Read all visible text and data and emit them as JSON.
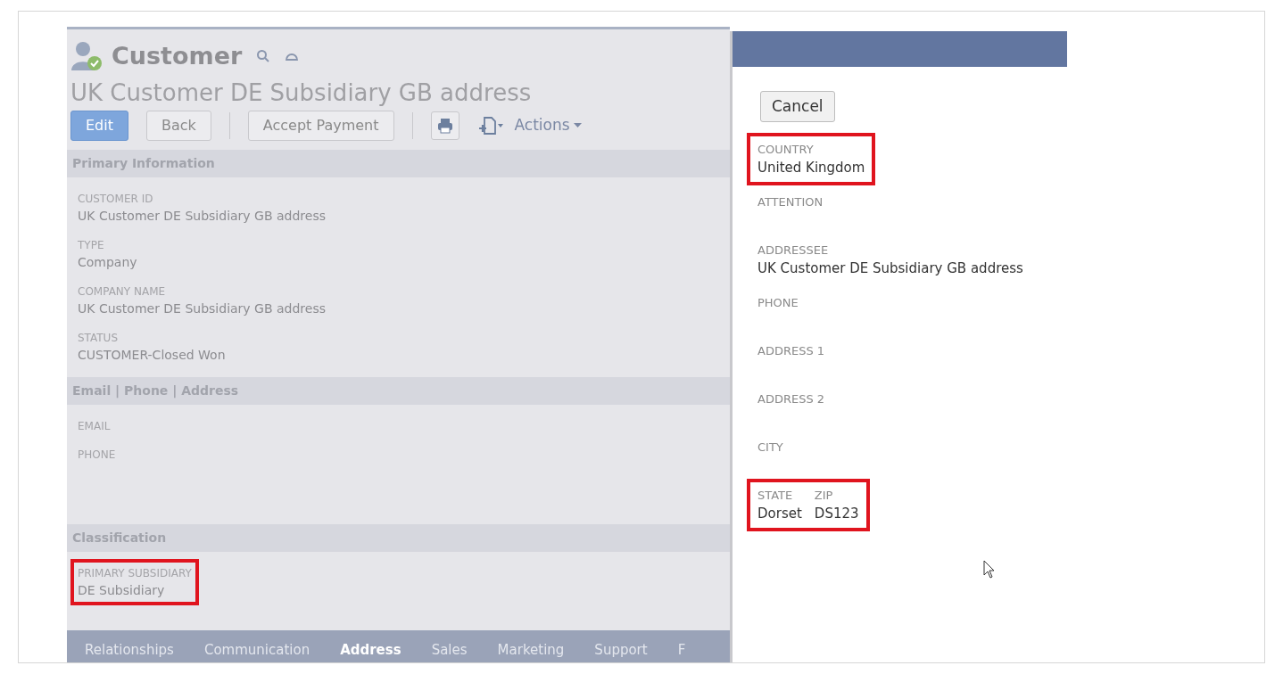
{
  "record": {
    "type_label": "Customer",
    "title": "UK Customer DE Subsidiary GB address"
  },
  "buttons": [
    {
      "label": "Edit",
      "kind": "primary"
    },
    {
      "label": "Back",
      "kind": "secondary"
    },
    {
      "label": "Accept Payment",
      "kind": "secondary"
    }
  ],
  "actions_menu": "Actions",
  "sections": [
    {
      "title": "Primary Information",
      "fields": [
        {
          "label": "CUSTOMER ID",
          "value": "UK Customer DE Subsidiary GB address",
          "highlighted": false
        },
        {
          "label": "TYPE",
          "value": "Company",
          "highlighted": false
        },
        {
          "label": "COMPANY NAME",
          "value": "UK Customer DE Subsidiary GB address",
          "highlighted": false
        },
        {
          "label": "STATUS",
          "value": "CUSTOMER-Closed Won",
          "highlighted": false
        }
      ]
    },
    {
      "title": "Email | Phone | Address",
      "fields": [
        {
          "label": "EMAIL",
          "highlighted": false
        },
        {
          "label": "PHONE",
          "highlighted": false
        }
      ]
    },
    {
      "title": "Classification",
      "fields": [
        {
          "label": "PRIMARY SUBSIDIARY",
          "value": "DE Subsidiary",
          "highlighted": true
        }
      ]
    }
  ],
  "subtabs": [
    {
      "label": "Relationships",
      "selected": false
    },
    {
      "label": "Communication",
      "selected": false
    },
    {
      "label": "Address",
      "selected": true
    },
    {
      "label": "Sales",
      "selected": false
    },
    {
      "label": "Marketing",
      "selected": false
    },
    {
      "label": "Support",
      "selected": false
    },
    {
      "label": "F",
      "selected": false
    }
  ],
  "address_popup": {
    "cancel_button": "Cancel",
    "fields": [
      {
        "highlighted": true,
        "columns": [
          {
            "label": "COUNTRY",
            "value": "United Kingdom"
          }
        ]
      },
      {
        "highlighted": false,
        "columns": [
          {
            "label": "ATTENTION"
          }
        ]
      },
      {
        "highlighted": false,
        "columns": [
          {
            "label": "ADDRESSEE",
            "value": "UK Customer DE Subsidiary GB address"
          }
        ]
      },
      {
        "highlighted": false,
        "columns": [
          {
            "label": "PHONE"
          }
        ]
      },
      {
        "highlighted": false,
        "columns": [
          {
            "label": "ADDRESS 1"
          }
        ]
      },
      {
        "highlighted": false,
        "columns": [
          {
            "label": "ADDRESS 2"
          }
        ]
      },
      {
        "highlighted": false,
        "columns": [
          {
            "label": "CITY"
          }
        ]
      },
      {
        "highlighted": true,
        "columns": [
          {
            "label": "STATE",
            "value": "Dorset"
          },
          {
            "label": "ZIP",
            "value": "DS123"
          }
        ]
      }
    ]
  }
}
